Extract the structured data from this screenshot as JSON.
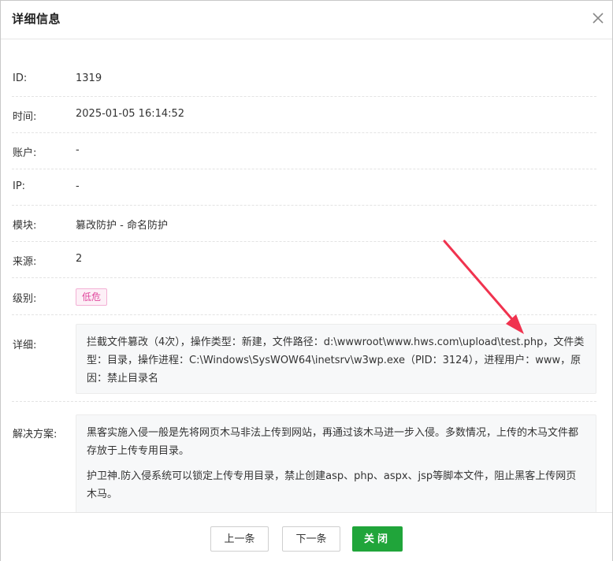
{
  "dialog": {
    "title": "详细信息",
    "close_icon": "close-icon"
  },
  "fields": {
    "id": {
      "label": "ID:",
      "value": "1319"
    },
    "time": {
      "label": "时间:",
      "value": "2025-01-05 16:14:52"
    },
    "account": {
      "label": "账户:",
      "value": "-"
    },
    "ip": {
      "label": "IP:",
      "value": "-"
    },
    "module": {
      "label": "模块:",
      "value": "篡改防护 - 命名防护"
    },
    "source": {
      "label": "来源:",
      "value": "2"
    },
    "level": {
      "label": "级别:",
      "value": "低危",
      "color": "#e0479d"
    },
    "detail": {
      "label": "详细:",
      "value": "拦截文件篡改（4次），操作类型：新建，文件路径：d:\\wwwroot\\www.hws.com\\upload\\test.php，文件类型：目录，操作进程：C:\\Windows\\SysWOW64\\inetsrv\\w3wp.exe（PID：3124），进程用户：www，原因：禁止目录名"
    },
    "solution": {
      "label": "解决方案:",
      "paragraphs": [
        "黑客实施入侵一般是先将网页木马非法上传到网站，再通过该木马进一步入侵。多数情况，上传的木马文件都存放于上传专用目录。",
        "护卫神.防入侵系统可以锁定上传专用目录，禁止创建asp、php、aspx、jsp等脚本文件，阻止黑客上传网页木马。"
      ]
    }
  },
  "footer": {
    "prev_label": "上一条",
    "next_label": "下一条",
    "close_label": "关闭",
    "accent_color": "#20a53a"
  },
  "annotation": {
    "arrow_color": "#f0334f"
  }
}
